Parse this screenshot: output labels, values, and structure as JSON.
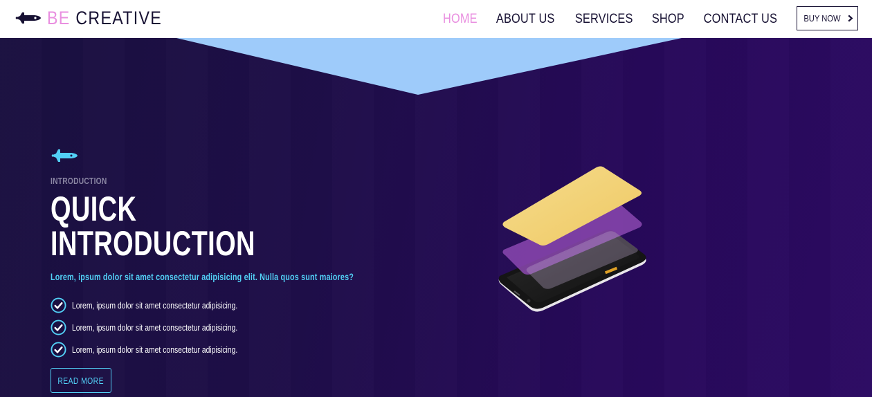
{
  "brand": {
    "accent": "BE",
    "main": "CREATIVE",
    "icon": "spaceship-icon",
    "accent_color": "#e98fe0",
    "dark_color": "#171133"
  },
  "nav": {
    "items": [
      {
        "label": "HOME",
        "active": true
      },
      {
        "label": "ABOUT US",
        "active": false
      },
      {
        "label": "SERVICES",
        "active": false
      },
      {
        "label": "SHOP",
        "active": false
      },
      {
        "label": "CONTACT US",
        "active": false
      }
    ],
    "cta": {
      "label": "BUY NOW",
      "icon": "chevron-right-icon"
    }
  },
  "hero": {
    "icon": "spaceship-icon",
    "eyebrow": "INTRODUCTION",
    "title_line1": "QUICK",
    "title_line2": "INTRODUCTION",
    "lead": "Lorem, ipsum dolor sit amet consectetur adipisicing elit. Nulla quos sunt maiores?",
    "features": [
      {
        "icon": "check-circle-icon",
        "text": "Lorem, ipsum dolor sit amet consectetur adipisicing."
      },
      {
        "icon": "check-circle-icon",
        "text": "Lorem, ipsum dolor sit amet consectetur adipisicing."
      },
      {
        "icon": "check-circle-icon",
        "text": "Lorem, ipsum dolor sit amet consectetur adipisicing."
      }
    ],
    "button_label": "READ MORE",
    "illustration": "smartphone-layers-illustration",
    "colors": {
      "accent_cyan": "#52d0f6",
      "top_shape": "#9ecbfa",
      "card_gold": "#f0cf72",
      "card_purple": "#8b48b0"
    }
  }
}
